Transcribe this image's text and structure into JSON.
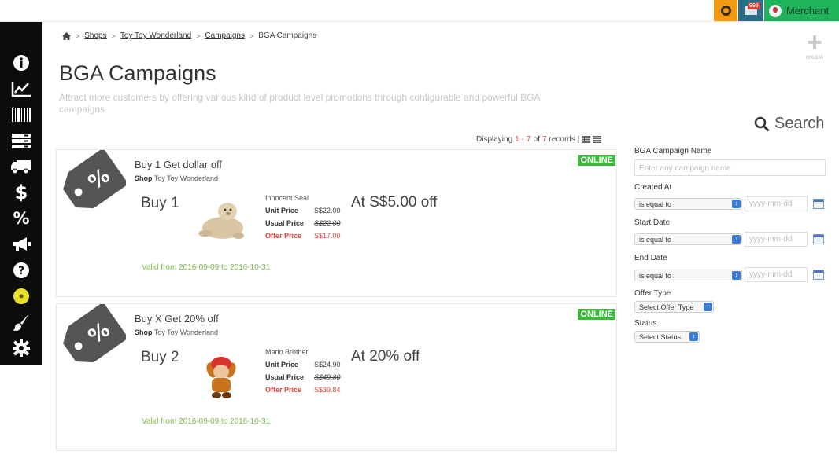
{
  "topbar": {
    "notification_count": "999",
    "user_label": "Merchant"
  },
  "sidebar": {
    "items": [
      {
        "icon": "info-icon"
      },
      {
        "icon": "analytics-chart-icon"
      },
      {
        "icon": "barcode-icon"
      },
      {
        "icon": "server-list-icon"
      },
      {
        "icon": "truck-icon"
      },
      {
        "icon": "dollar-icon"
      },
      {
        "icon": "percent-icon"
      },
      {
        "icon": "megaphone-icon"
      },
      {
        "icon": "help-icon"
      },
      {
        "icon": "circle-icon"
      },
      {
        "icon": "brush-icon"
      },
      {
        "icon": "gear-icon"
      }
    ]
  },
  "breadcrumb": {
    "home_icon": "home-icon",
    "items": [
      "Shops",
      "Toy Toy Wonderland",
      "Campaigns"
    ],
    "current": "BGA Campaigns"
  },
  "create": {
    "label": "create"
  },
  "page": {
    "title": "BGA Campaigns",
    "description": "Attract more customers by offering various kind of product level promotions through configurable and powerful BGA campaigns."
  },
  "records": {
    "prefix": "Displaying",
    "from": "1",
    "dash": "-",
    "to": "7",
    "of": "of",
    "total": "7",
    "suffix": "records |"
  },
  "campaigns": [
    {
      "name": "Buy 1 Get dollar off",
      "shop_label": "Shop",
      "shop": "Toy Toy Wonderland",
      "status": "ONLINE",
      "buy": "Buy 1",
      "product_name": "Innocent Seal",
      "unit_price_label": "Unit Price",
      "unit_price": "S$22.00",
      "usual_price_label": "Usual Price",
      "usual_price": "S$22.00",
      "offer_price_label": "Offer Price",
      "offer_price": "S$17.00",
      "discount": "At S$5.00 off",
      "valid": "Valid from 2016-09-09 to 2016-10-31"
    },
    {
      "name": "Buy X Get 20% off",
      "shop_label": "Shop",
      "shop": "Toy Toy Wonderland",
      "status": "ONLINE",
      "buy": "Buy 2",
      "product_name": "Mario Brother",
      "unit_price_label": "Unit Price",
      "unit_price": "S$24.90",
      "usual_price_label": "Usual Price",
      "usual_price": "S$49.80",
      "offer_price_label": "Offer Price",
      "offer_price": "S$39.84",
      "discount": "At 20% off",
      "valid": "Valid from 2016-09-09 to 2016-10-31"
    }
  ],
  "search": {
    "title": "Search",
    "name_label": "BGA Campaign Name",
    "name_placeholder": "Enter any campaign name",
    "created_label": "Created At",
    "created_op": "is equal to",
    "start_label": "Start Date",
    "start_op": "is equal to",
    "end_label": "End Date",
    "end_op": "is equal to",
    "date_placeholder": "yyyy-mm-dd",
    "offer_type_label": "Offer Type",
    "offer_type_value": "Select Offer Type",
    "status_label": "Status",
    "status_value": "Select Status"
  },
  "colors": {
    "accent_red": "#e0443a",
    "online_green": "#3cb83c",
    "merchant_green": "#1fb35c",
    "valid_green": "#7dbb4e"
  }
}
